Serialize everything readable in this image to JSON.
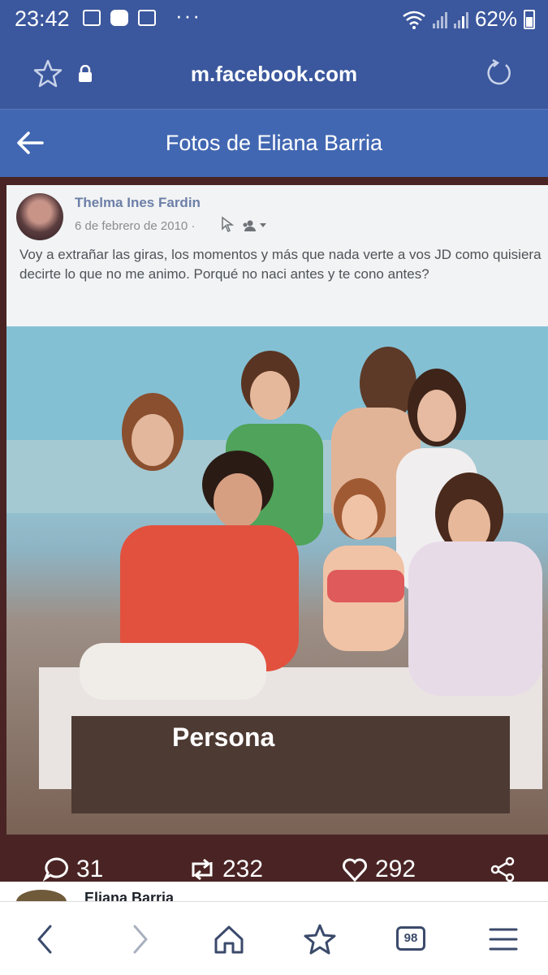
{
  "status_bar": {
    "time": "23:42",
    "dots": "···",
    "battery": "62%"
  },
  "browser": {
    "url": "m.facebook.com"
  },
  "header": {
    "title": "Fotos de Eliana Barria"
  },
  "post": {
    "author": "Thelma Ines Fardin",
    "date": "6 de febrero de 2010 ·",
    "text": "Voy a extrañar las giras, los momentos y más que nada verte a vos JD como quisiera decirte lo que no me animo. Porqué no naci antes y te cono antes?",
    "photo_sign": "Persona"
  },
  "reactions": {
    "comments": "31",
    "shares": "232",
    "likes": "292"
  },
  "comment_preview": {
    "name": "Eliana Barria"
  },
  "bottom_nav": {
    "tab_count": "98"
  }
}
